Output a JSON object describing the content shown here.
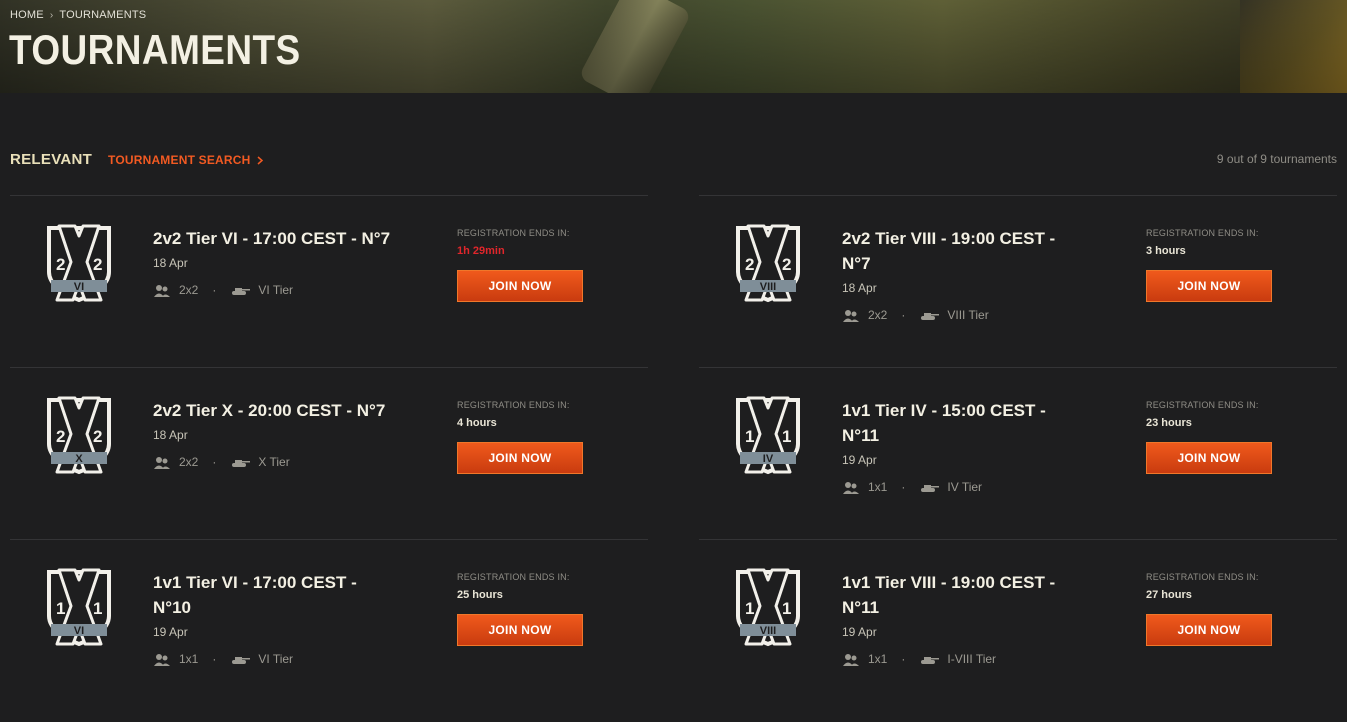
{
  "breadcrumb": {
    "home": "HOME",
    "current": "TOURNAMENTS"
  },
  "page_title": "TOURNAMENTS",
  "toolbar": {
    "relevant": "RELEVANT",
    "search": "TOURNAMENT SEARCH",
    "count": "9 out of 9 tournaments"
  },
  "reg_label": "REGISTRATION ENDS IN:",
  "join_label": "JOIN NOW",
  "colors": {
    "accent": "#f05a1c",
    "urgent": "#e0262b",
    "background": "#1e1e1f"
  },
  "cards": [
    {
      "name": "2v2 Tier VI - 17:00 CEST - N°7",
      "date": "18 Apr",
      "mode": "2x2",
      "tier": "VI Tier",
      "emblem_left": "2",
      "emblem_right": "2",
      "emblem_tier": "VI",
      "reg_value": "1h 29min",
      "urgent": true
    },
    {
      "name": "2v2 Tier VIII - 19:00 CEST - N°7",
      "date": "18 Apr",
      "mode": "2x2",
      "tier": "VIII Tier",
      "emblem_left": "2",
      "emblem_right": "2",
      "emblem_tier": "VIII",
      "reg_value": "3 hours",
      "urgent": false
    },
    {
      "name": "2v2 Tier X - 20:00 CEST - N°7",
      "date": "18 Apr",
      "mode": "2x2",
      "tier": "X Tier",
      "emblem_left": "2",
      "emblem_right": "2",
      "emblem_tier": "X",
      "reg_value": "4 hours",
      "urgent": false
    },
    {
      "name": "1v1 Tier IV - 15:00 CEST - N°11",
      "date": "19 Apr",
      "mode": "1x1",
      "tier": "IV Tier",
      "emblem_left": "1",
      "emblem_right": "1",
      "emblem_tier": "IV",
      "reg_value": "23 hours",
      "urgent": false
    },
    {
      "name": "1v1 Tier VI - 17:00 CEST - N°10",
      "date": "19 Apr",
      "mode": "1x1",
      "tier": "VI Tier",
      "emblem_left": "1",
      "emblem_right": "1",
      "emblem_tier": "VI",
      "reg_value": "25 hours",
      "urgent": false
    },
    {
      "name": "1v1 Tier VIII - 19:00 CEST - N°11",
      "date": "19 Apr",
      "mode": "1x1",
      "tier": "I-VIII Tier",
      "emblem_left": "1",
      "emblem_right": "1",
      "emblem_tier": "VIII",
      "reg_value": "27 hours",
      "urgent": false
    }
  ]
}
